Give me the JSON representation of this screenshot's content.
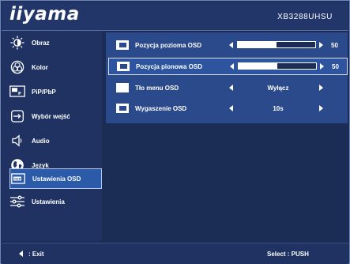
{
  "header": {
    "logo": "iiyama",
    "model": "XB3288UHSU"
  },
  "sidebar": {
    "items": [
      {
        "label": "Obraz",
        "icon": "brightness-icon"
      },
      {
        "label": "Kolor",
        "icon": "color-icon"
      },
      {
        "label": "PiP/PbP",
        "icon": "pip-icon"
      },
      {
        "label": "Wybór wejść",
        "icon": "input-icon"
      },
      {
        "label": "Audio",
        "icon": "speaker-icon"
      },
      {
        "label": "Język",
        "icon": "globe-icon"
      },
      {
        "label": "Ustawienia OSD",
        "icon": "osd-icon",
        "active": true
      },
      {
        "label": "Ustawienia",
        "icon": "settings-sliders-icon"
      }
    ]
  },
  "submenu": {
    "rows": [
      {
        "label": "Pozycja pozioma OSD",
        "type": "slider",
        "value": "50",
        "level": 0.5
      },
      {
        "label": "Pozycja pionowa OSD",
        "type": "slider",
        "value": "50",
        "level": 0.5,
        "selected": true
      },
      {
        "label": "Tło menu OSD",
        "type": "option",
        "value": "Wyłącz"
      },
      {
        "label": "Wygaszenie OSD",
        "type": "option",
        "value": "10s"
      }
    ]
  },
  "footer": {
    "exit_label": ": Exit",
    "select_label": "Select : PUSH"
  },
  "colors": {
    "background": "#1c2d55",
    "panel": "#2b4a8c",
    "active": "#2a5aa8",
    "text": "#ffffff"
  }
}
